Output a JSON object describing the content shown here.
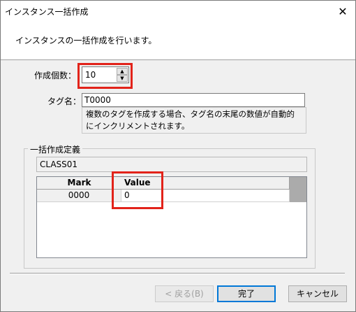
{
  "window": {
    "title": "インスタンス一括作成",
    "close_glyph": "✕"
  },
  "header": {
    "description": "インスタンスの一括作成を行います。"
  },
  "form": {
    "count_label": "作成個数：",
    "count_value": "10",
    "tag_label": "タグ名：",
    "tag_value": "T0000",
    "note": "複数のタグを作成する場合、タグ名の末尾の数値が自動的にインクリメントされます。"
  },
  "definition": {
    "group_label": "一括作成定義",
    "class_name": "CLASS01",
    "columns": [
      "Mark",
      "Value"
    ],
    "rows": [
      {
        "mark": "0000",
        "value": "0"
      }
    ]
  },
  "buttons": {
    "back": "< 戻る(B)",
    "finish": "完了",
    "cancel": "キャンセル"
  },
  "colors": {
    "highlight": "#e2231a",
    "default_button_border": "#0078d7"
  },
  "icons": {
    "close": "close-icon",
    "spin_up": "spin-up-arrow-icon",
    "spin_down": "spin-down-arrow-icon"
  }
}
